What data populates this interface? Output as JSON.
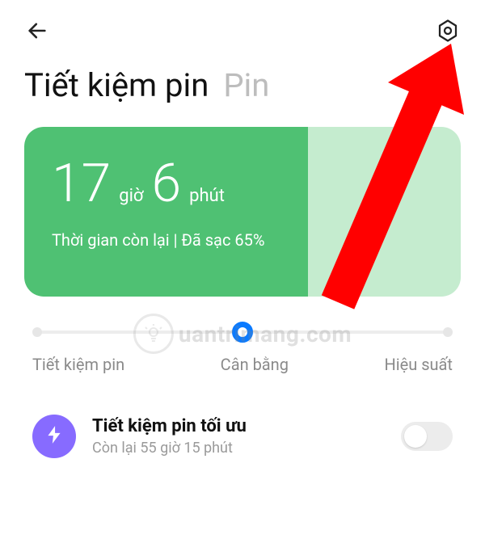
{
  "tabs": {
    "active": "Tiết kiệm pin",
    "inactive": "Pin"
  },
  "battery": {
    "hours": "17",
    "hours_unit": "giờ",
    "minutes": "6",
    "minutes_unit": "phút",
    "status": "Thời gian còn lại | Đã sạc 65%",
    "fill_percent": 65
  },
  "slider": {
    "left_label": "Tiết kiệm pin",
    "center_label": "Cân bằng",
    "right_label": "Hiệu suất"
  },
  "optimal": {
    "title": "Tiết kiệm pin tối ưu",
    "subtitle": "Còn lại 55 giờ 15 phút",
    "toggle_on": false
  },
  "watermark": {
    "text": "uantrimang.com"
  },
  "colors": {
    "accent_green": "#4fc173",
    "accent_blue": "#0a7aff",
    "bolt_purple": "#876bff",
    "arrow_red": "#ff0000"
  }
}
